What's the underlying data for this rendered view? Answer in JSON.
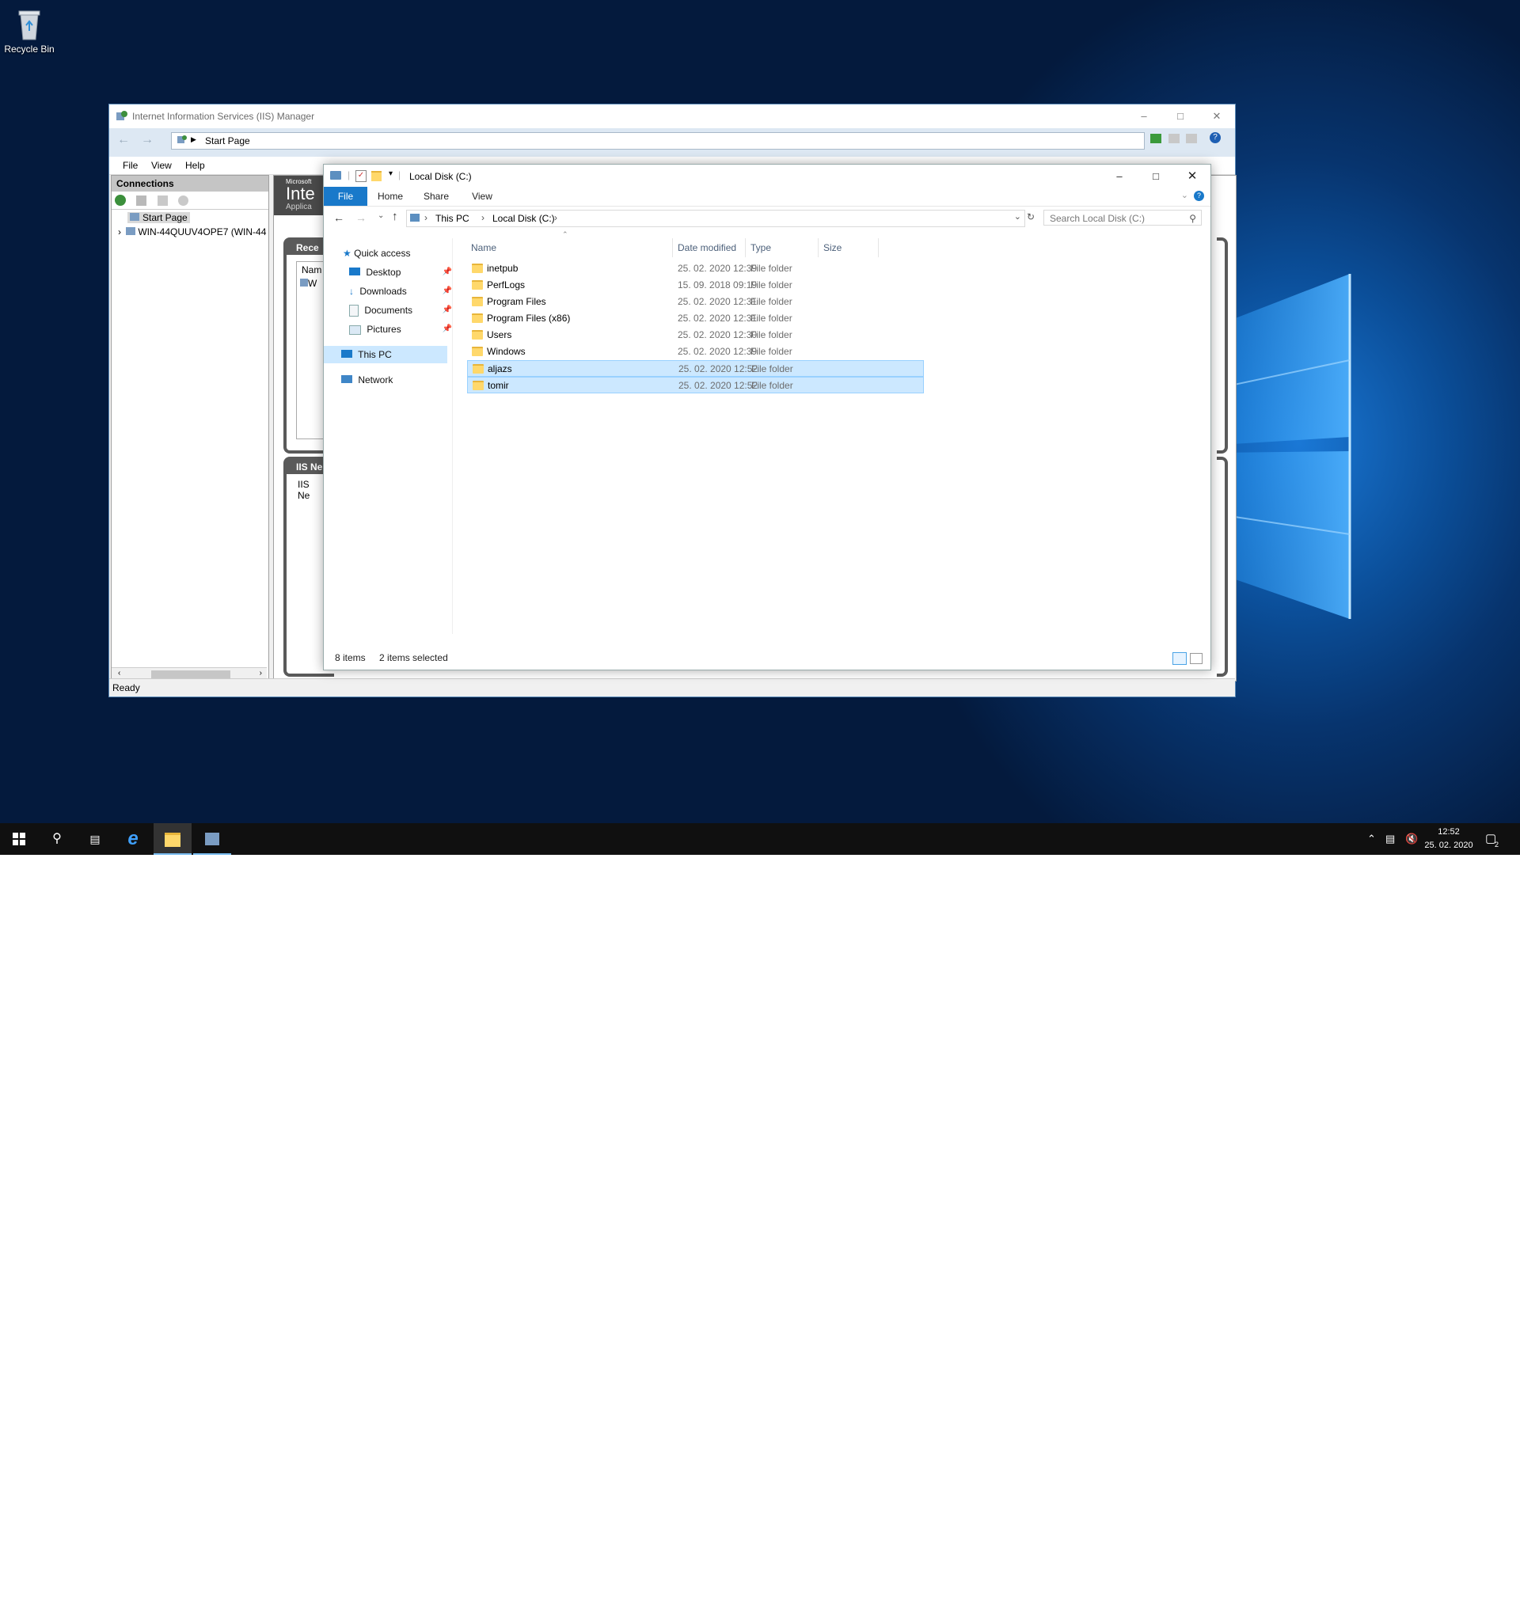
{
  "desktop": {
    "recycle_bin_label": "Recycle Bin"
  },
  "iis": {
    "title": "Internet Information Services (IIS) Manager",
    "address": "Start Page",
    "menu": [
      "File",
      "View",
      "Help"
    ],
    "connections_header": "Connections",
    "tree": [
      "Start Page",
      "WIN-44QUUV4OPE7 (WIN-44"
    ],
    "banner_small": "Microsoft",
    "banner_big": "Inte",
    "banner_sub": "Applica",
    "recent_header": "Rece",
    "recent_col": "Nam",
    "recent_item": "W",
    "news_header": "IIS Ne",
    "news_text": "IIS Ne",
    "status": "Ready"
  },
  "explorer": {
    "title": "Local Disk (C:)",
    "ribbon_tabs": [
      "File",
      "Home",
      "Share",
      "View"
    ],
    "breadcrumb": [
      "This PC",
      "Local Disk (C:)"
    ],
    "search_placeholder": "Search Local Disk (C:)",
    "nav_items": [
      {
        "label": "Quick access",
        "icon": "star-icon"
      },
      {
        "label": "Desktop",
        "icon": "desktop-icon",
        "pinned": true
      },
      {
        "label": "Downloads",
        "icon": "download-icon",
        "pinned": true
      },
      {
        "label": "Documents",
        "icon": "documents-icon",
        "pinned": true
      },
      {
        "label": "Pictures",
        "icon": "pictures-icon",
        "pinned": true
      },
      {
        "label": "This PC",
        "icon": "computer-icon",
        "selected": true
      },
      {
        "label": "Network",
        "icon": "network-icon"
      }
    ],
    "columns": [
      "Name",
      "Date modified",
      "Type",
      "Size"
    ],
    "files": [
      {
        "name": "inetpub",
        "date": "25. 02. 2020 12:39",
        "type": "File folder",
        "selected": false
      },
      {
        "name": "PerfLogs",
        "date": "15. 09. 2018 09:19",
        "type": "File folder",
        "selected": false
      },
      {
        "name": "Program Files",
        "date": "25. 02. 2020 12:31",
        "type": "File folder",
        "selected": false
      },
      {
        "name": "Program Files (x86)",
        "date": "25. 02. 2020 12:31",
        "type": "File folder",
        "selected": false
      },
      {
        "name": "Users",
        "date": "25. 02. 2020 12:30",
        "type": "File folder",
        "selected": false
      },
      {
        "name": "Windows",
        "date": "25. 02. 2020 12:39",
        "type": "File folder",
        "selected": false
      },
      {
        "name": "aljazs",
        "date": "25. 02. 2020 12:52",
        "type": "File folder",
        "selected": true
      },
      {
        "name": "tomir",
        "date": "25. 02. 2020 12:52",
        "type": "File folder",
        "selected": true
      }
    ],
    "status_count": "8 items",
    "status_selected": "2 items selected"
  },
  "taskbar": {
    "time": "12:52",
    "date": "25. 02. 2020",
    "notification_count": "2"
  },
  "colors": {
    "accent": "#1979ca",
    "selection": "#cce8ff",
    "taskbar": "#101010"
  }
}
